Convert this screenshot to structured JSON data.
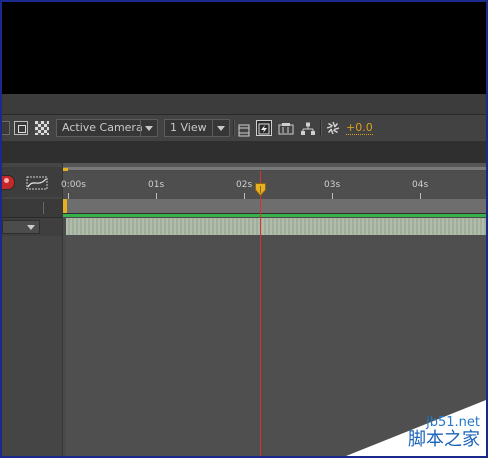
{
  "toolbar": {
    "camera_view": "Active Camera",
    "view_layout": "1 View",
    "exposure": "+0.0"
  },
  "timeline": {
    "ruler_labels": [
      "0:00s",
      "01s",
      "02s",
      "03s",
      "04s"
    ],
    "playhead_marker": "▾"
  },
  "watermark": {
    "site": "jb51.net",
    "name": "脚本之家"
  },
  "colors": {
    "playhead": "#d93030",
    "work_area_green": "#37b24a",
    "exposure_text": "#d9a020",
    "cti_marker": "#e6b020"
  }
}
